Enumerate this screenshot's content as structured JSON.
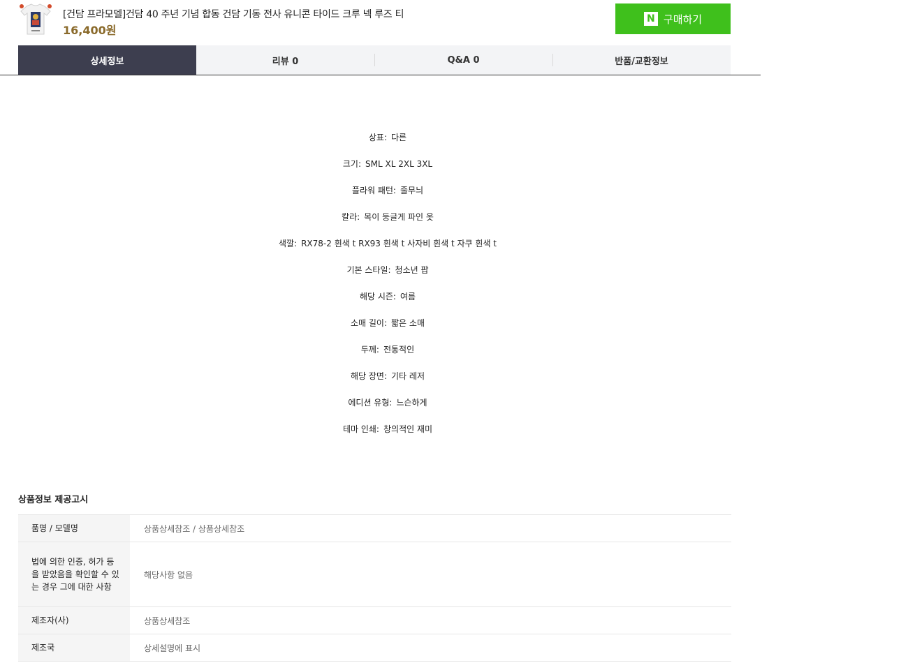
{
  "product": {
    "title": "[건담 프라모델]건담 40 주년 기념 합동 건담 기동 전사 유니콘 타이드 크루 넥 루즈 티",
    "price": "16,400원"
  },
  "buy_button": {
    "badge": "N",
    "label": "구매하기"
  },
  "tabs": [
    {
      "label": "상세정보",
      "active": true
    },
    {
      "label": "리뷰 0",
      "active": false
    },
    {
      "label": "Q&A 0",
      "active": false
    },
    {
      "label": "반품/교환정보",
      "active": false
    }
  ],
  "specs": [
    {
      "label": "상표:",
      "value": "다른"
    },
    {
      "label": "크기:",
      "value": "SML XL 2XL 3XL"
    },
    {
      "label": "플라워 패턴:",
      "value": "줄무늬"
    },
    {
      "label": "칼라:",
      "value": "목이 둥글게 파인 옷"
    },
    {
      "label": "색깔:",
      "value": "RX78-2 흰색 t RX93 흰색 t 사자비 흰색 t 자쿠 흰색 t"
    },
    {
      "label": "기본 스타일:",
      "value": "청소년 팝"
    },
    {
      "label": "해당 시즌:",
      "value": "여름"
    },
    {
      "label": "소매 길이:",
      "value": "짧은 소매"
    },
    {
      "label": "두께:",
      "value": "전통적인"
    },
    {
      "label": "해당 장면:",
      "value": "기타 레저"
    },
    {
      "label": "에디션 유형:",
      "value": "느슨하게"
    },
    {
      "label": "테마 인쇄:",
      "value": "창의적인 재미"
    }
  ],
  "notice": {
    "title": "상품정보 제공고시",
    "rows": [
      {
        "key": "품명 / 모델명",
        "value": "상품상세참조 / 상품상세참조"
      },
      {
        "key": "법에 의한 인증, 허가 등을 받았음을 확인할 수 있는 경우 그에 대한 사항",
        "value": "해당사항 없음"
      },
      {
        "key": "제조자(사)",
        "value": "상품상세참조"
      },
      {
        "key": "제조국",
        "value": "상세설명에 표시"
      }
    ]
  }
}
